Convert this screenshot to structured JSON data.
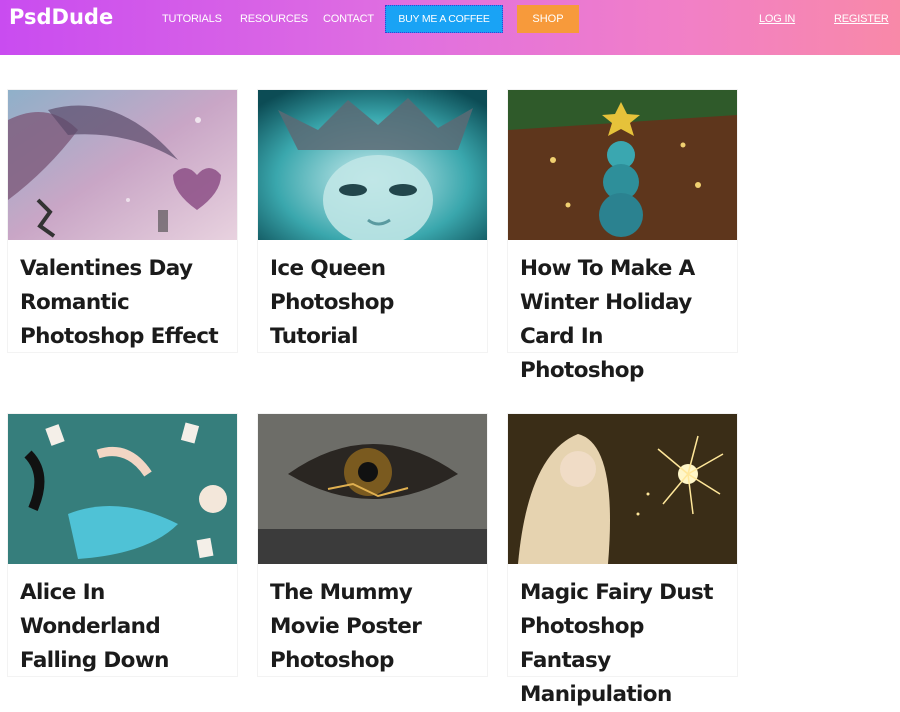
{
  "header": {
    "logo": "PsdDude",
    "nav": [
      "TUTORIALS",
      "RESOURCES",
      "CONTACT"
    ],
    "coffee_button": "BUY ME A COFFEE",
    "shop_button": "SHOP",
    "login": "LOG IN",
    "register": "REGISTER"
  },
  "cards": [
    {
      "title": "Valentines Day Romantic Photoshop Effect",
      "thumb": "valentines-heart-thumbnail"
    },
    {
      "title": "Ice Queen Photoshop Tutorial",
      "thumb": "ice-queen-thumbnail"
    },
    {
      "title": "How To Make A Winter Holiday Card In Photoshop",
      "thumb": "christmas-tree-thumbnail"
    },
    {
      "title": "Alice In Wonderland Falling Down",
      "thumb": "alice-wonderland-thumbnail"
    },
    {
      "title": "The Mummy Movie Poster Photoshop",
      "thumb": "mummy-eye-thumbnail"
    },
    {
      "title": "Magic Fairy Dust Photoshop Fantasy Manipulation",
      "thumb": "fairy-dust-thumbnail"
    }
  ]
}
